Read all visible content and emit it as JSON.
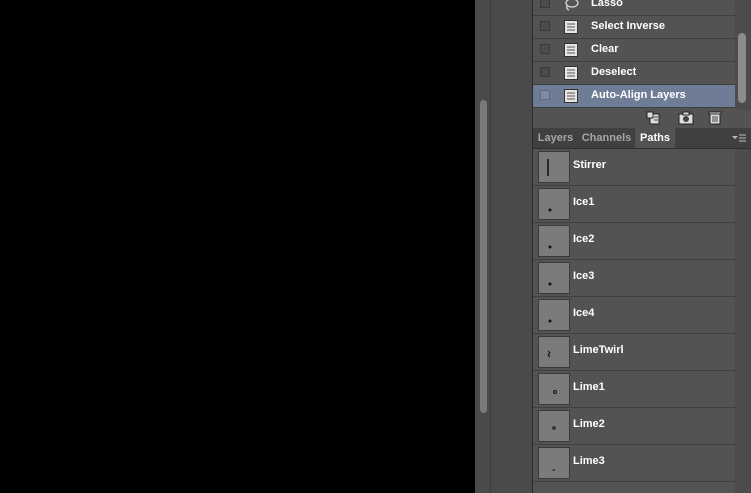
{
  "history": {
    "items": [
      {
        "label": "Lasso",
        "icon": "lasso-icon"
      },
      {
        "label": "Select Inverse",
        "icon": "history-state-icon"
      },
      {
        "label": "Clear",
        "icon": "history-state-icon"
      },
      {
        "label": "Deselect",
        "icon": "history-state-icon"
      },
      {
        "label": "Auto-Align Layers",
        "icon": "history-state-icon",
        "selected": true
      }
    ],
    "buttons": [
      "new-document-from-state-icon",
      "camera-icon",
      "trash-icon"
    ]
  },
  "panel_tabs": {
    "items": [
      {
        "label": "Layers"
      },
      {
        "label": "Channels"
      },
      {
        "label": "Paths",
        "active": true
      }
    ],
    "menu_icon": "panel-menu-icon"
  },
  "paths": {
    "items": [
      {
        "label": "Stirrer"
      },
      {
        "label": "Ice1"
      },
      {
        "label": "Ice2"
      },
      {
        "label": "Ice3"
      },
      {
        "label": "Ice4"
      },
      {
        "label": "LimeTwirl"
      },
      {
        "label": "Lime1"
      },
      {
        "label": "Lime2"
      },
      {
        "label": "Lime3"
      }
    ]
  },
  "colors": {
    "canvas": "#000000",
    "panel_bg": "#535353",
    "selected_row": "#6f7c96"
  }
}
